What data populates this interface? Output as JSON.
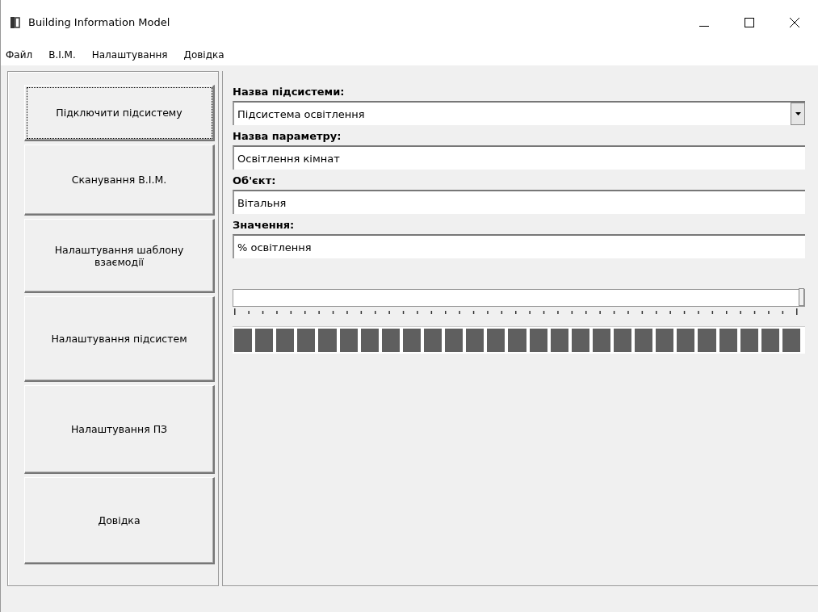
{
  "window": {
    "title": "Building Information Model"
  },
  "menu": [
    {
      "label": "Файл"
    },
    {
      "label": "В.І.М."
    },
    {
      "label": "Налаштування"
    },
    {
      "label": "Довідка"
    }
  ],
  "sidebar": {
    "buttons": [
      {
        "label": "Підключити підсистему",
        "focused": true
      },
      {
        "label": "Сканування В.І.М.",
        "focused": false
      },
      {
        "label": "Налаштування шаблону взаємодії",
        "focused": false
      },
      {
        "label": "Налаштування підсистем",
        "focused": false
      },
      {
        "label": "Налаштування ПЗ",
        "focused": false
      },
      {
        "label": "Довідка",
        "focused": false
      }
    ]
  },
  "form": {
    "fields": [
      {
        "kind": "dropdown",
        "label": "Назва підсистеми:",
        "value": "Підсистема освітлення"
      },
      {
        "kind": "text",
        "label": "Назва параметру:",
        "value": "Освітлення кімнат"
      },
      {
        "kind": "text",
        "label": "Об'єкт:",
        "value": "Вітальня"
      },
      {
        "kind": "text",
        "label": "Значення:",
        "value": "% освітлення"
      }
    ],
    "slider": {
      "level": 1
    },
    "progress": {
      "level": 1
    }
  }
}
